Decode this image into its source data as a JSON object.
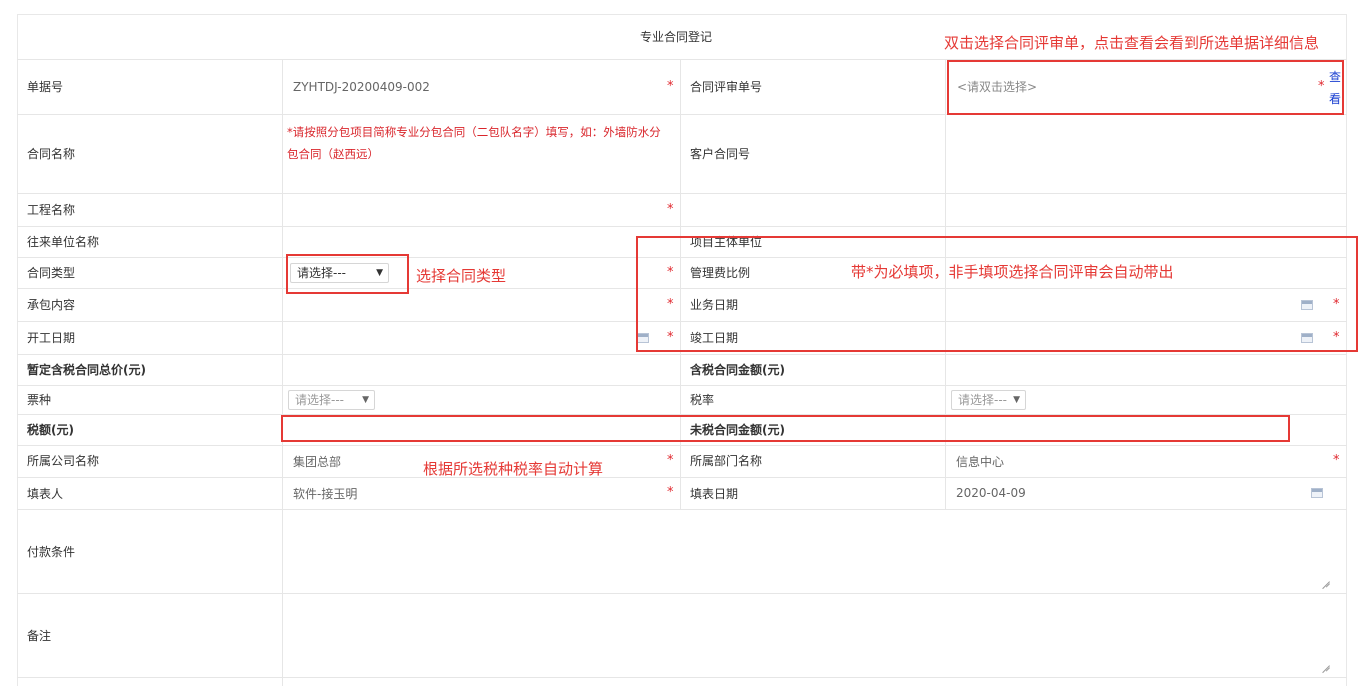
{
  "form": {
    "title": "专业合同登记",
    "rows": {
      "doc_no": {
        "label": "单据号",
        "value": "ZYHTDJ-20200409-002"
      },
      "review_no": {
        "label": "合同评审单号",
        "placeholder": "<请双击选择>",
        "view_link": "查看"
      },
      "contract_name": {
        "label": "合同名称",
        "hint": "*请按照分包项目简称专业分包合同（二包队名字）填写，如：外墙防水分包合同（赵西远）"
      },
      "customer_contract_no": {
        "label": "客户合同号"
      },
      "project_name": {
        "label": "工程名称"
      },
      "partner_name": {
        "label": "往来单位名称"
      },
      "project_main_unit": {
        "label": "项目主体单位"
      },
      "contract_type": {
        "label": "合同类型",
        "selected": "请选择---"
      },
      "mgmt_fee_ratio": {
        "label": "管理费比例"
      },
      "contract_content": {
        "label": "承包内容"
      },
      "business_date": {
        "label": "业务日期"
      },
      "start_date": {
        "label": "开工日期"
      },
      "completion_date": {
        "label": "竣工日期"
      },
      "est_total_price": {
        "label": "暂定含税合同总价(元)"
      },
      "tax_incl_amount": {
        "label": "含税合同金额(元)"
      },
      "invoice_type": {
        "label": "票种",
        "selected": "请选择---"
      },
      "tax_rate": {
        "label": "税率",
        "selected": "请选择---"
      },
      "tax_amount": {
        "label": "税额(元)"
      },
      "tax_excl_amount": {
        "label": "未税合同金额(元)"
      },
      "company_name": {
        "label": "所属公司名称",
        "value": "集团总部"
      },
      "department_name": {
        "label": "所属部门名称",
        "value": "信息中心"
      },
      "filler": {
        "label": "填表人",
        "value": "软件-接玉明"
      },
      "fill_date": {
        "label": "填表日期",
        "value": "2020-04-09"
      },
      "payment_terms": {
        "label": "付款条件"
      },
      "remarks": {
        "label": "备注"
      }
    }
  },
  "annotations": {
    "review_hint": "双击选择合同评审单，点击查看会看到所选单据详细信息",
    "type_hint": "选择合同类型",
    "required_hint": "带*为必填项，非手填项选择合同评审会自动带出",
    "tax_hint": "根据所选税种税率自动计算"
  },
  "required_mark": "*",
  "colors": {
    "annotation": "#e53935",
    "required": "#e0262c",
    "link": "#1a3fd1",
    "hint": "#d9262c"
  }
}
